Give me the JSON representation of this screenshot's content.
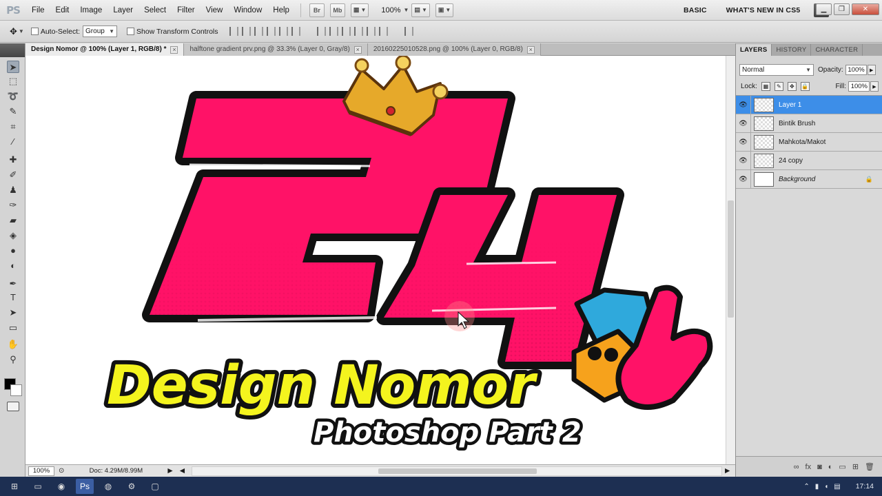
{
  "app": {
    "logo": "PS",
    "menu": [
      "File",
      "Edit",
      "Image",
      "Layer",
      "Select",
      "Filter",
      "View",
      "Window",
      "Help"
    ],
    "quick_icons": [
      "Br",
      "Mb"
    ],
    "zoom_level": "100%",
    "workspace": {
      "basic": "BASIC",
      "whats_new": "WHAT'S NEW IN CS5"
    }
  },
  "options_bar": {
    "auto_select_label": "Auto-Select:",
    "auto_select_value": "Group",
    "show_transform_label": "Show Transform Controls"
  },
  "tabs": [
    {
      "label": "Design Nomor @ 100% (Layer 1, RGB/8) *",
      "active": true
    },
    {
      "label": "halftone gradient prv.png @ 33.3% (Layer 0, Gray/8)",
      "active": false
    },
    {
      "label": "20160225010528.png @ 100% (Layer 0, RGB/8)",
      "active": false
    }
  ],
  "status": {
    "zoom": "100%",
    "doc": "Doc: 4.29M/8.99M"
  },
  "artwork": {
    "number": "24",
    "title": "Design Nomor",
    "subtitle": "Photoshop Part 2",
    "colors": {
      "pink": "#ff1267",
      "yellow": "#f4f41e",
      "outline": "#111111",
      "crown": "#e6a92a",
      "cap": "#2fa9dc",
      "face": "#f6a21c"
    }
  },
  "layers_panel": {
    "tabs": [
      "LAYERS",
      "HISTORY",
      "CHARACTER"
    ],
    "blend_mode": "Normal",
    "opacity_label": "Opacity:",
    "opacity": "100%",
    "lock_label": "Lock:",
    "fill_label": "Fill:",
    "fill": "100%",
    "layers": [
      {
        "name": "Layer 1",
        "selected": true
      },
      {
        "name": "Bintik Brush",
        "selected": false
      },
      {
        "name": "Mahkota/Makot",
        "selected": false
      },
      {
        "name": "24 copy",
        "selected": false
      },
      {
        "name": "Background",
        "selected": false,
        "italic": true,
        "locked": true
      }
    ]
  },
  "taskbar": {
    "time": "17:14"
  }
}
